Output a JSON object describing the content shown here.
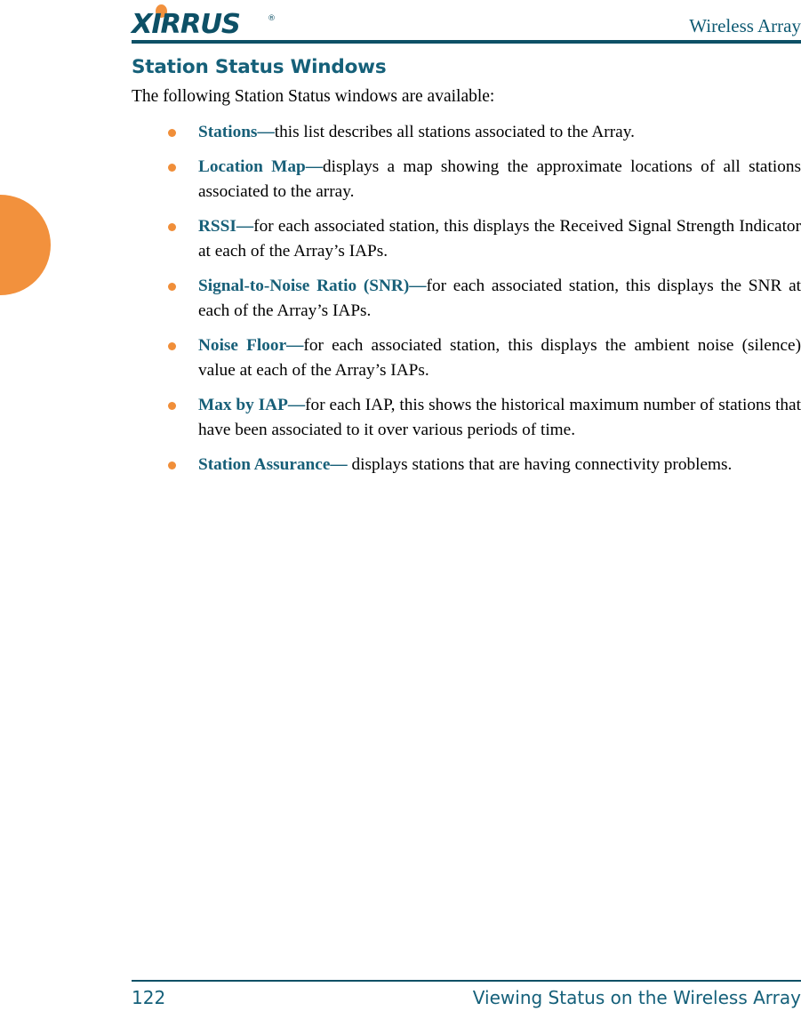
{
  "colors": {
    "teal_dark": "#0d5066",
    "teal_heading": "#156079",
    "teal_term": "#175f78",
    "orange": "#f08e39",
    "body_text": "#000000"
  },
  "header": {
    "logo_word": "XIRRUS",
    "logo_trademark": "®",
    "title": "Wireless Array"
  },
  "main": {
    "page_title": "Station Status Windows",
    "intro": "The following Station Status windows are available:",
    "bullets": [
      {
        "term": "Stations",
        "dash": "—",
        "description": "this list describes all stations associated to the Array."
      },
      {
        "term": "Location Map",
        "dash": "—",
        "description": "displays a map showing the approximate locations of all stations associated to the array."
      },
      {
        "term": "RSSI",
        "dash": "—",
        "description": "for each associated station, this displays the Received Signal Strength Indicator at each of the Array’s IAPs."
      },
      {
        "term": "Signal-to-Noise Ratio (SNR)",
        "dash": "—",
        "description": "for each associated station, this displays the SNR at each of the Array’s IAPs."
      },
      {
        "term": "Noise Floor",
        "dash": "—",
        "description": "for each associated station, this displays the ambient noise (silence) value at each of the Array’s IAPs."
      },
      {
        "term": "Max by IAP",
        "dash": "—",
        "description": "for each IAP, this shows the historical maximum number of stations that have been associated to it over various periods of time."
      },
      {
        "term": "Station Assurance",
        "dash": "— ",
        "description": "displays stations that are having connectivity problems."
      }
    ]
  },
  "footer": {
    "page_number": "122",
    "title": "Viewing Status on the Wireless Array"
  }
}
